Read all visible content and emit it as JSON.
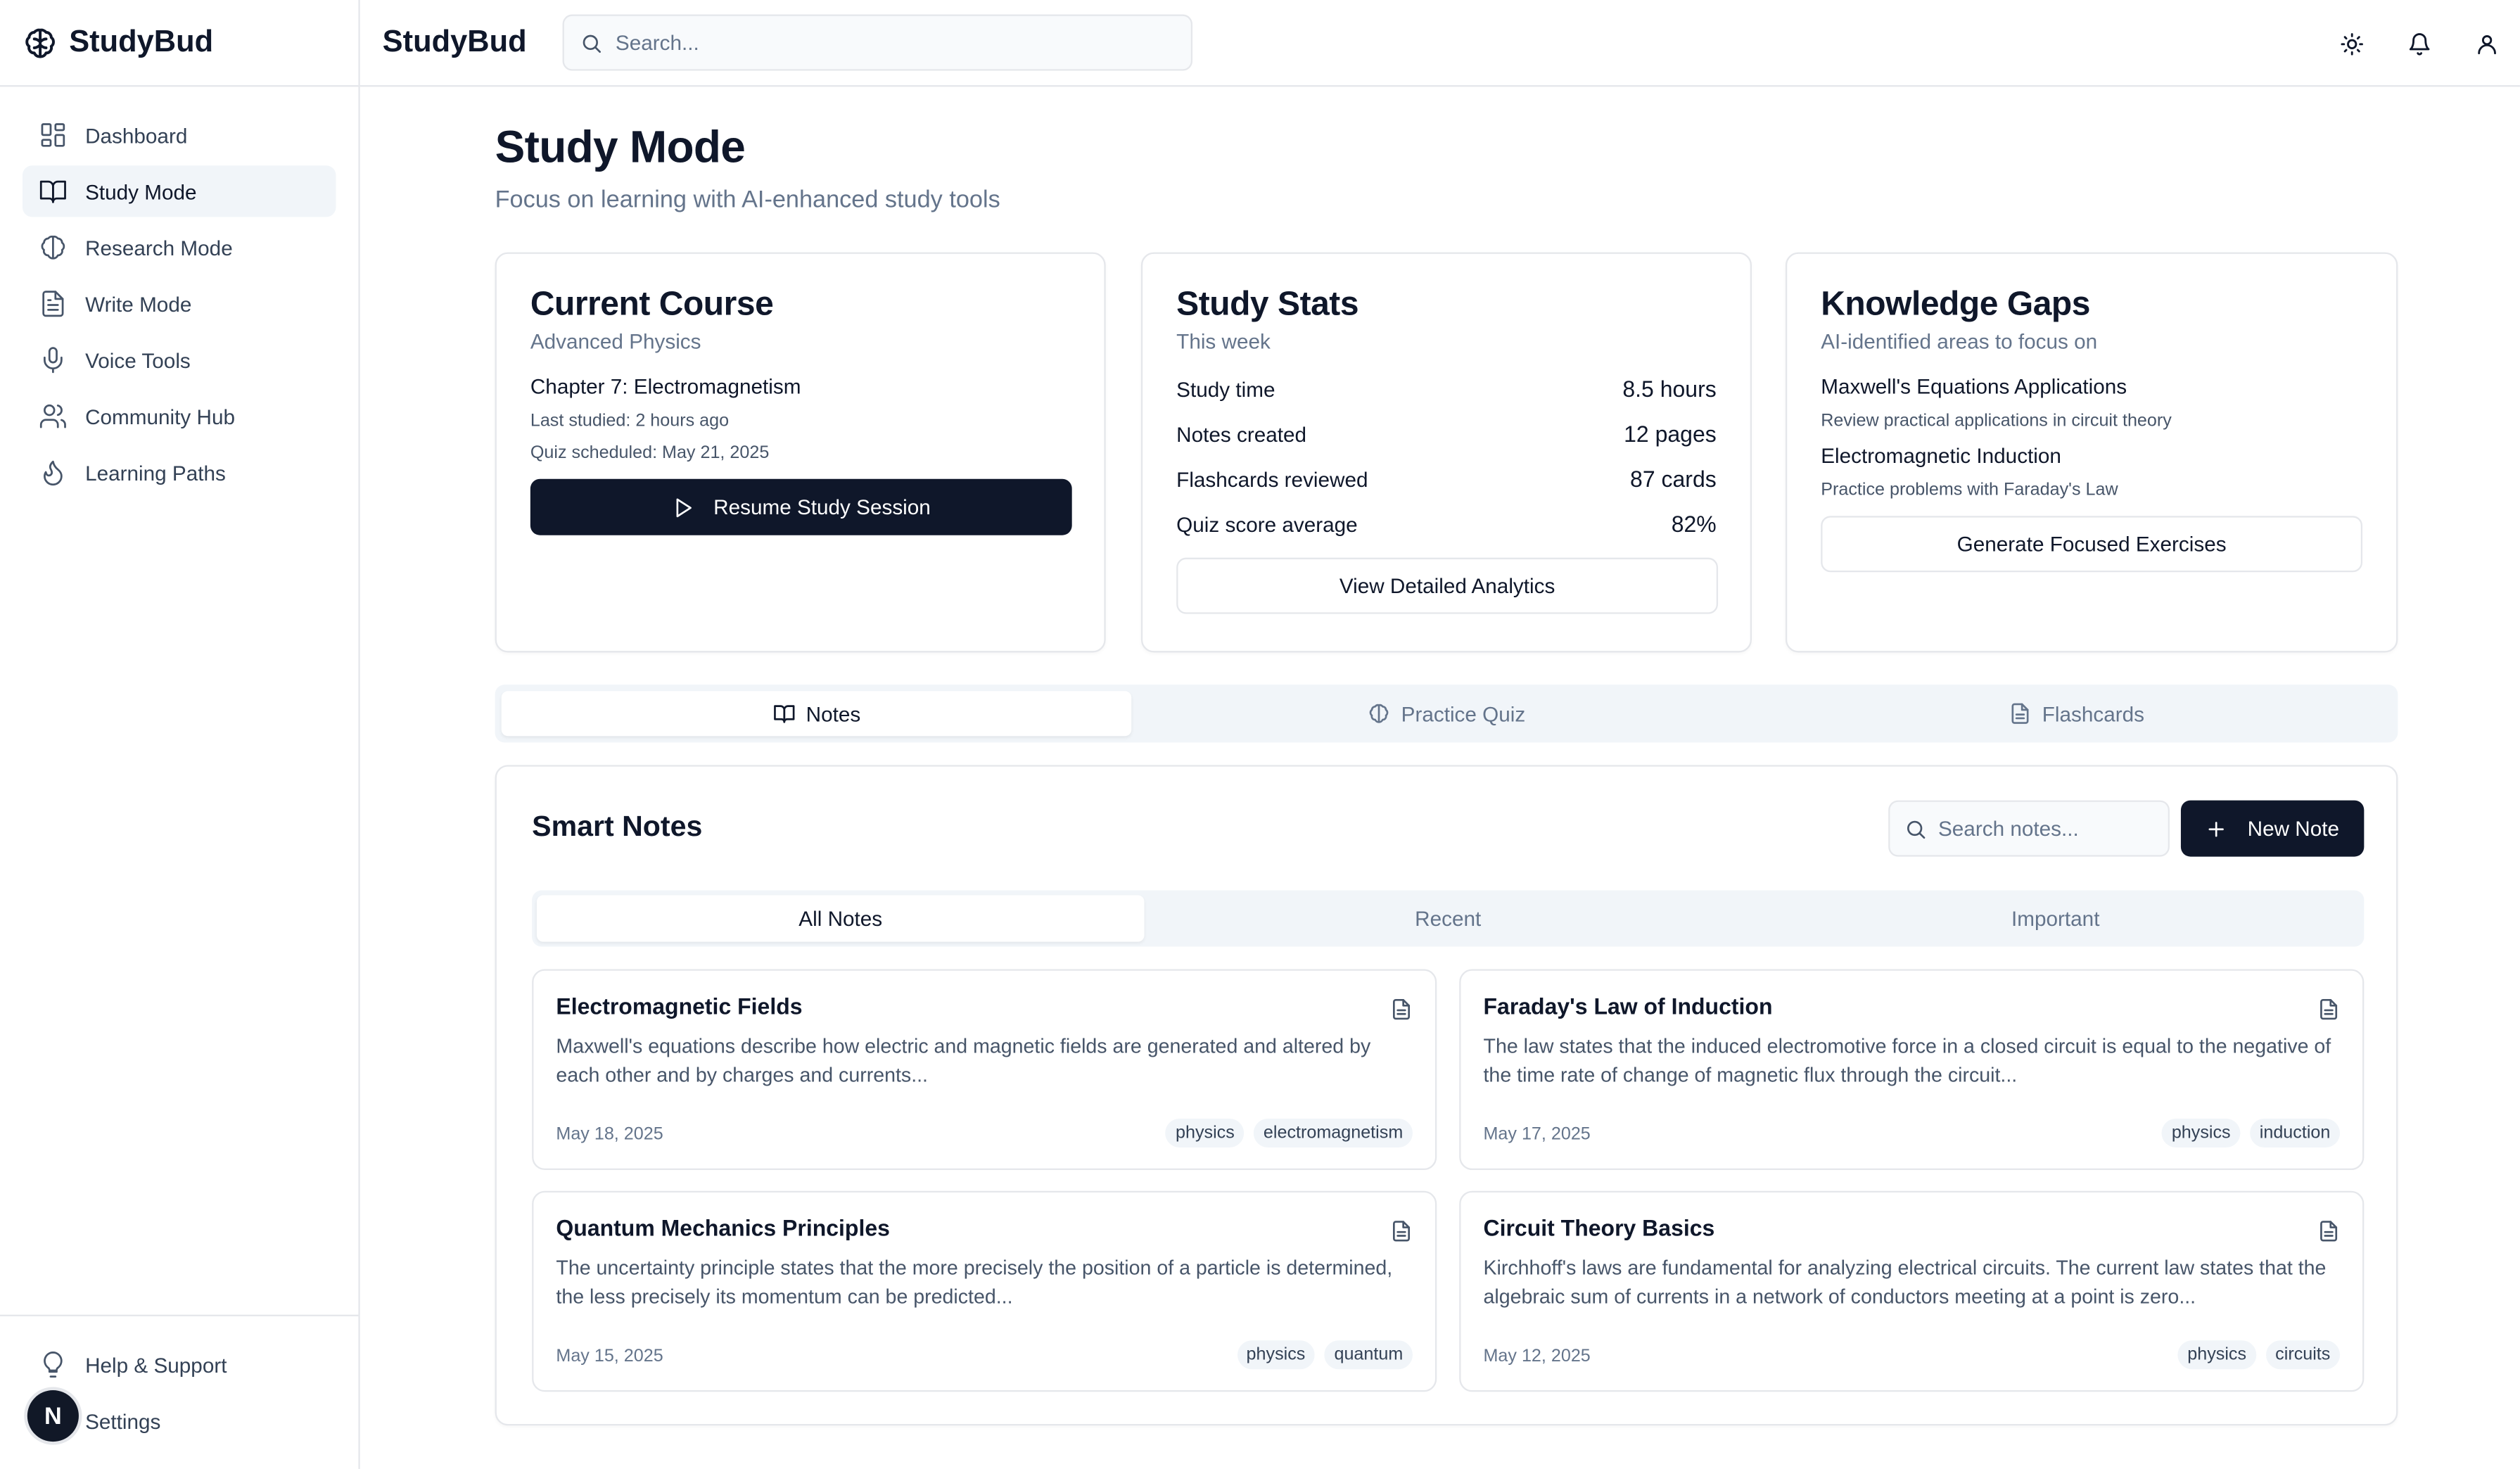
{
  "sidebar": {
    "brand": "StudyBud",
    "nav": [
      {
        "label": "Dashboard",
        "icon": "dashboard-icon"
      },
      {
        "label": "Study Mode",
        "icon": "book-icon",
        "active": true
      },
      {
        "label": "Research Mode",
        "icon": "brain-icon"
      },
      {
        "label": "Write Mode",
        "icon": "file-text-icon"
      },
      {
        "label": "Voice Tools",
        "icon": "mic-icon"
      },
      {
        "label": "Community Hub",
        "icon": "users-icon"
      },
      {
        "label": "Learning Paths",
        "icon": "flame-icon"
      }
    ],
    "bottom": [
      {
        "label": "Help & Support",
        "icon": "lightbulb-icon"
      },
      {
        "label": "Settings",
        "icon": "settings-icon"
      }
    ],
    "avatar_letter": "N"
  },
  "header": {
    "title": "StudyBud",
    "search_placeholder": "Search..."
  },
  "page": {
    "title": "Study Mode",
    "subtitle": "Focus on learning with AI-enhanced study tools"
  },
  "current_course": {
    "title": "Current Course",
    "subtitle": "Advanced Physics",
    "chapter": "Chapter 7: Electromagnetism",
    "last_studied": "Last studied: 2 hours ago",
    "quiz": "Quiz scheduled: May 21, 2025",
    "button": "Resume Study Session"
  },
  "study_stats": {
    "title": "Study Stats",
    "subtitle": "This week",
    "rows": [
      {
        "label": "Study time",
        "value": "8.5 hours"
      },
      {
        "label": "Notes created",
        "value": "12 pages"
      },
      {
        "label": "Flashcards reviewed",
        "value": "87 cards"
      },
      {
        "label": "Quiz score average",
        "value": "82%"
      }
    ],
    "button": "View Detailed Analytics"
  },
  "knowledge_gaps": {
    "title": "Knowledge Gaps",
    "subtitle": "AI-identified areas to focus on",
    "items": [
      {
        "title": "Maxwell's Equations Applications",
        "desc": "Review practical applications in circuit theory"
      },
      {
        "title": "Electromagnetic Induction",
        "desc": "Practice problems with Faraday's Law"
      }
    ],
    "button": "Generate Focused Exercises"
  },
  "tabs": [
    {
      "label": "Notes",
      "active": true
    },
    {
      "label": "Practice Quiz"
    },
    {
      "label": "Flashcards"
    }
  ],
  "smart_notes": {
    "title": "Smart Notes",
    "search_placeholder": "Search notes...",
    "new_button": "New Note",
    "subtabs": [
      {
        "label": "All Notes",
        "active": true
      },
      {
        "label": "Recent"
      },
      {
        "label": "Important"
      }
    ],
    "notes": [
      {
        "title": "Electromagnetic Fields",
        "body": "Maxwell's equations describe how electric and magnetic fields are generated and altered by each other and by charges and currents...",
        "date": "May 18, 2025",
        "tags": [
          "physics",
          "electromagnetism"
        ]
      },
      {
        "title": "Faraday's Law of Induction",
        "body": "The law states that the induced electromotive force in a closed circuit is equal to the negative of the time rate of change of magnetic flux through the circuit...",
        "date": "May 17, 2025",
        "tags": [
          "physics",
          "induction"
        ]
      },
      {
        "title": "Quantum Mechanics Principles",
        "body": "The uncertainty principle states that the more precisely the position of a particle is determined, the less precisely its momentum can be predicted...",
        "date": "May 15, 2025",
        "tags": [
          "physics",
          "quantum"
        ]
      },
      {
        "title": "Circuit Theory Basics",
        "body": "Kirchhoff's laws are fundamental for analyzing electrical circuits. The current law states that the algebraic sum of currents in a network of conductors meeting at a point is zero...",
        "date": "May 12, 2025",
        "tags": [
          "physics",
          "circuits"
        ]
      }
    ]
  },
  "colors": {
    "primary": "#0f172a",
    "muted_text": "#64748b",
    "border": "#e5e7eb",
    "muted_bg": "#f1f5f9"
  }
}
